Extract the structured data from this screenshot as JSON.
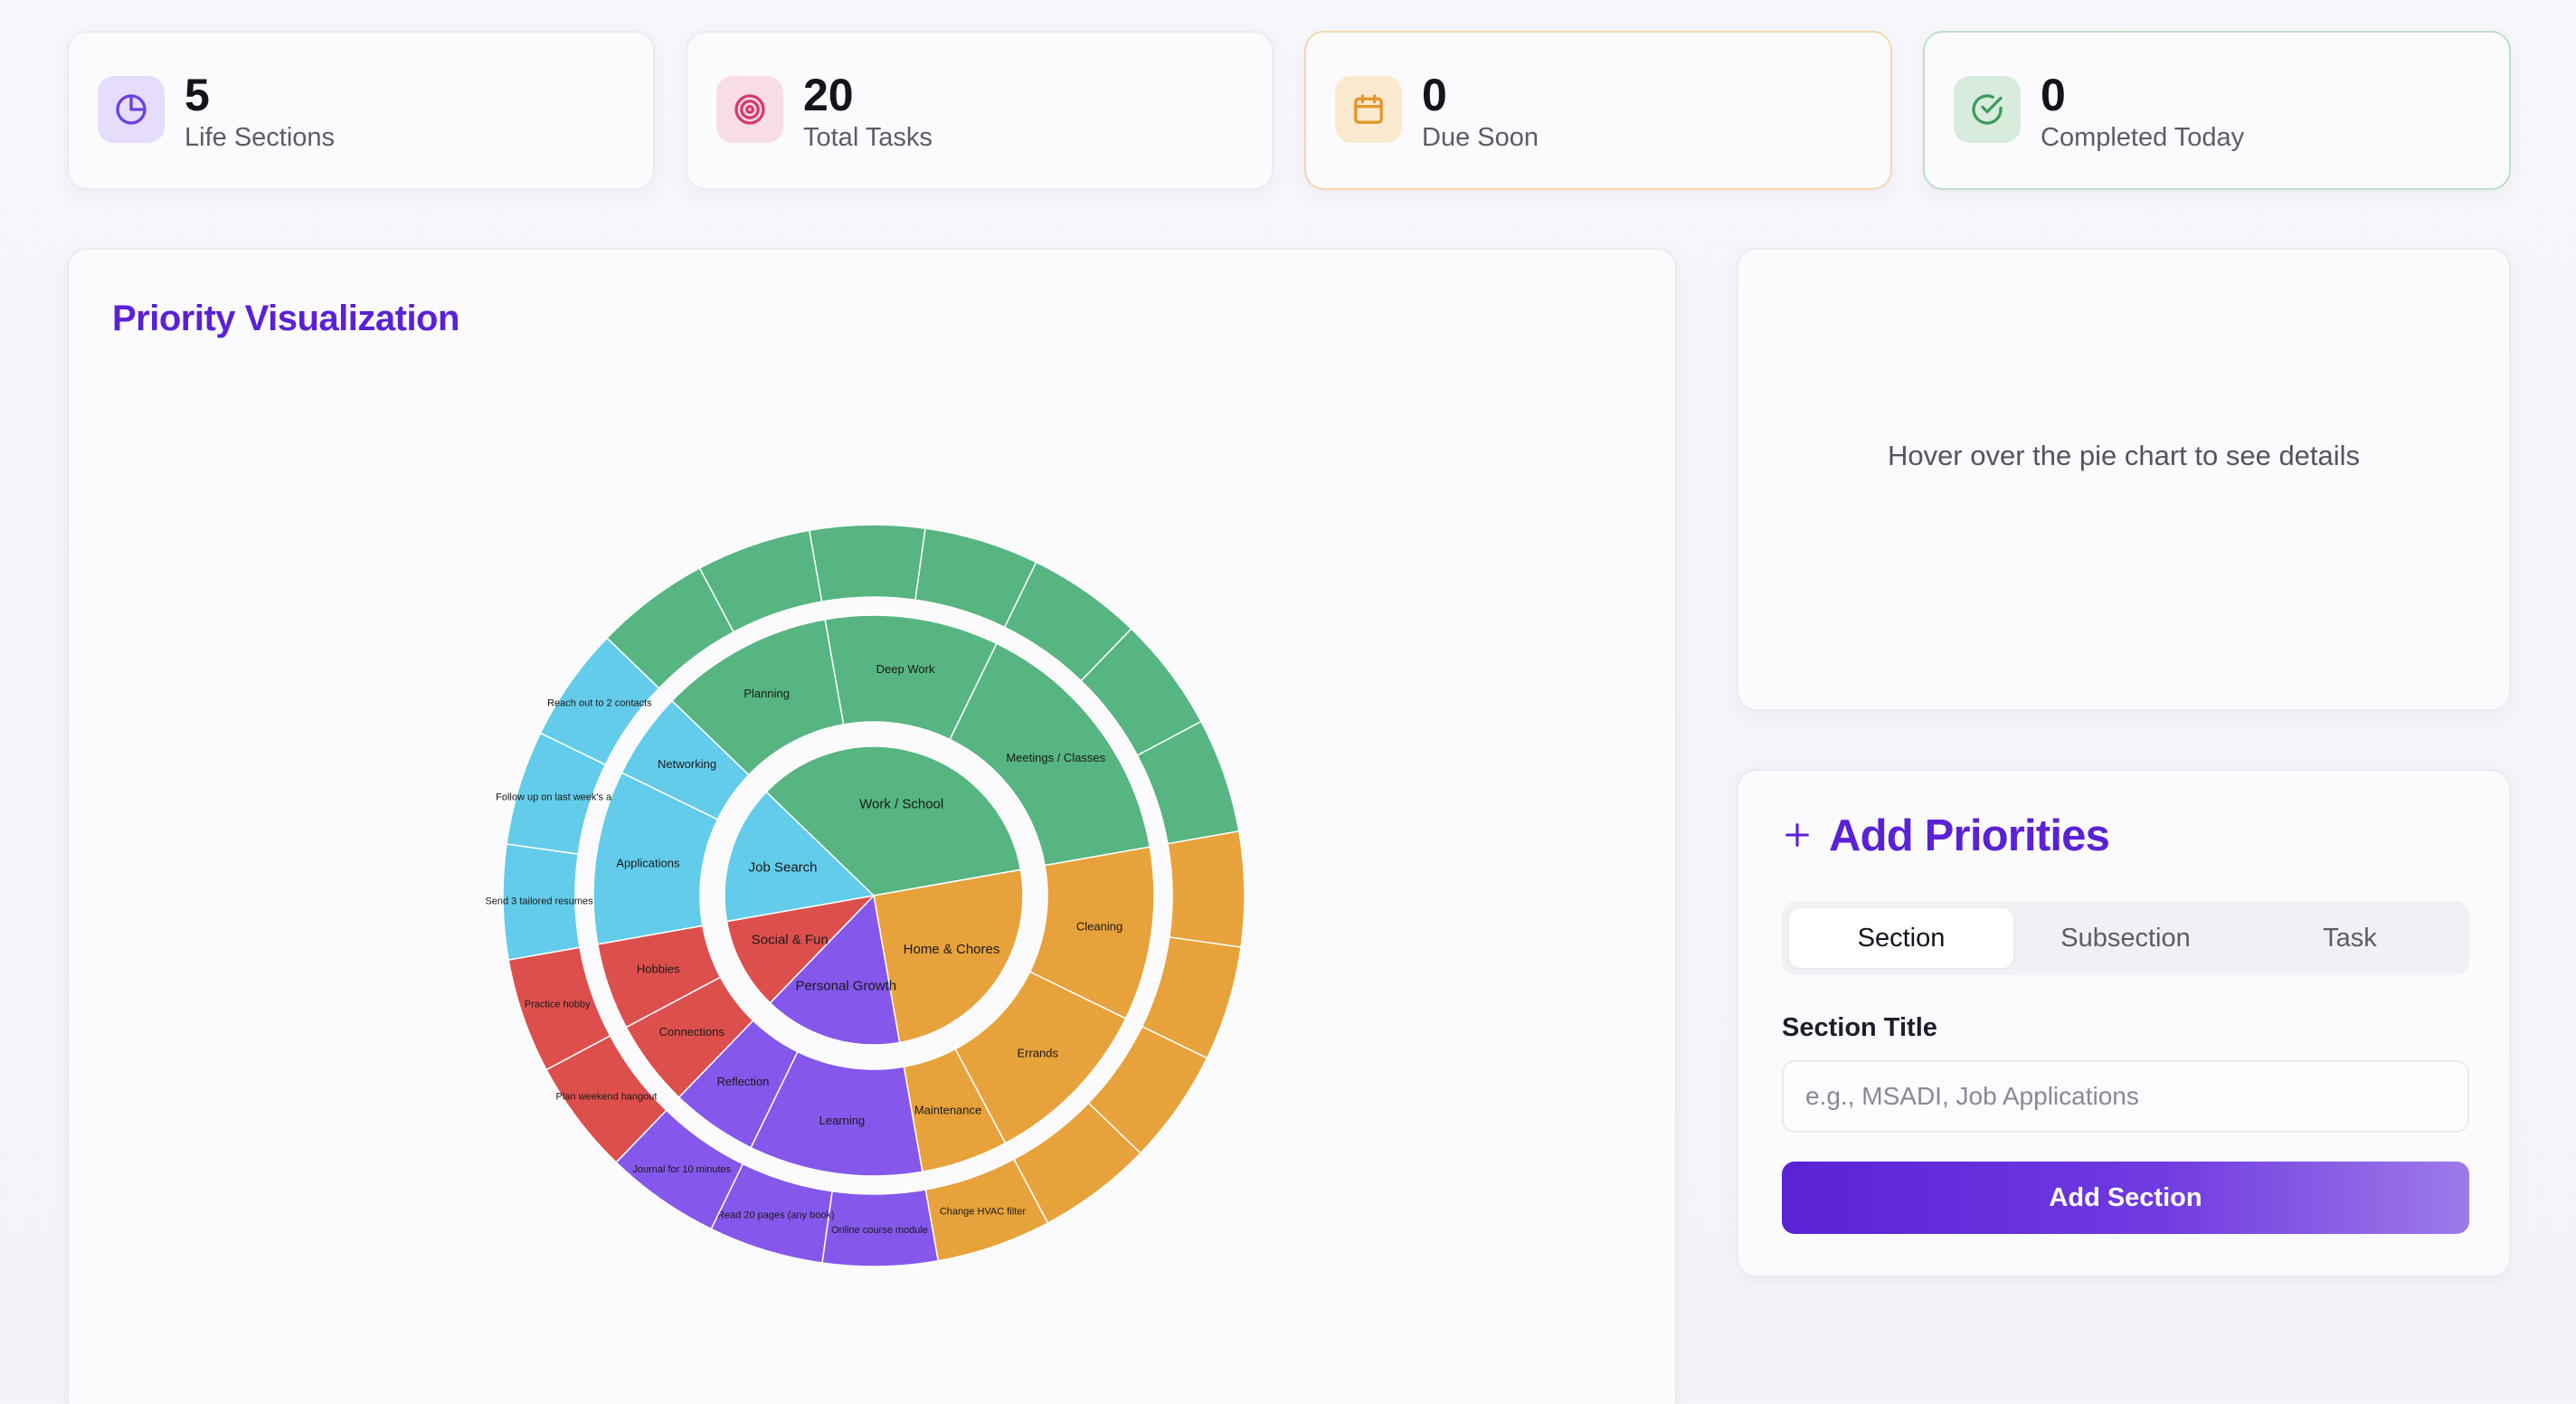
{
  "stats": [
    {
      "value": "5",
      "label": "Life Sections",
      "icon": "pie-chart-icon",
      "color": "#6d3fe0",
      "icon_bg": "#e6dcfb",
      "border": "#eceaf2"
    },
    {
      "value": "20",
      "label": "Total Tasks",
      "icon": "target-icon",
      "color": "#d63c6c",
      "icon_bg": "#f8dde6",
      "border": "#eceaf2"
    },
    {
      "value": "0",
      "label": "Due Soon",
      "icon": "calendar-icon",
      "color": "#e4962b",
      "icon_bg": "#fbe9cf",
      "border": "#f4d6b0"
    },
    {
      "value": "0",
      "label": "Completed Today",
      "icon": "check-circle-icon",
      "color": "#3e9b5c",
      "icon_bg": "#d8ecdd",
      "border": "#bddfc7"
    }
  ],
  "visualization": {
    "title": "Priority Visualization",
    "colors": {
      "job_search": "#63ccea",
      "work_school": "#56b580",
      "home_chores": "#e8a23b",
      "personal_growth": "#8557ea",
      "social_fun": "#dd4f4d"
    }
  },
  "chart_data": {
    "type": "sunburst",
    "sections": [
      {
        "name": "Job Search",
        "color": "#63ccea",
        "subsections": [
          {
            "name": "Applications",
            "tasks": [
              "Send 3 tailored resumes",
              "Follow up on last week's a"
            ]
          },
          {
            "name": "Networking",
            "tasks": [
              "Reach out to 2 contacts"
            ]
          }
        ]
      },
      {
        "name": "Work / School",
        "color": "#56b580",
        "subsections": [
          {
            "name": "Planning",
            "tasks": [
              "",
              ""
            ]
          },
          {
            "name": "Deep Work",
            "tasks": [
              "",
              ""
            ]
          },
          {
            "name": "Meetings / Classes",
            "tasks": [
              "",
              "",
              ""
            ]
          }
        ]
      },
      {
        "name": "Home & Chores",
        "color": "#e8a23b",
        "subsections": [
          {
            "name": "Cleaning",
            "tasks": [
              "",
              ""
            ]
          },
          {
            "name": "Errands",
            "tasks": [
              "",
              ""
            ]
          },
          {
            "name": "Maintenance",
            "tasks": [
              "Change HVAC filter"
            ]
          }
        ]
      },
      {
        "name": "Personal Growth",
        "color": "#8557ea",
        "subsections": [
          {
            "name": "Learning",
            "tasks": [
              "Online course module",
              "Read 20 pages (any book)"
            ]
          },
          {
            "name": "Reflection",
            "tasks": [
              "Journal for 10 minutes"
            ]
          }
        ]
      },
      {
        "name": "Social & Fun",
        "color": "#dd4f4d",
        "subsections": [
          {
            "name": "Connections",
            "tasks": [
              "Plan weekend hangout"
            ]
          },
          {
            "name": "Hobbies",
            "tasks": [
              "Practice hobby"
            ]
          }
        ]
      }
    ]
  },
  "details": {
    "placeholder": "Hover over the pie chart to see details"
  },
  "add_panel": {
    "title": "Add Priorities",
    "tabs": [
      "Section",
      "Subsection",
      "Task"
    ],
    "active_tab": "Section",
    "field_label": "Section Title",
    "field_placeholder": "e.g., MSADI, Job Applications",
    "field_value": "",
    "submit_label": "Add Section"
  }
}
